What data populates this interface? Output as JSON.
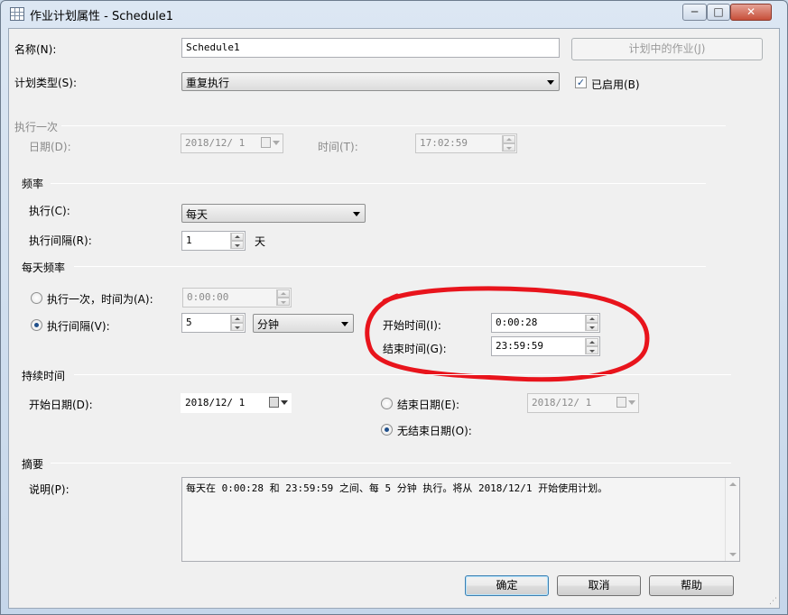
{
  "window": {
    "title": "作业计划属性 - Schedule1",
    "buttons": {
      "minimize": "─",
      "maximize": "□",
      "close": "✕"
    }
  },
  "name": {
    "label": "名称(N):",
    "value": "Schedule1"
  },
  "jobs_in_schedule_button": "计划中的作业(J)",
  "schedule_type": {
    "label": "计划类型(S):",
    "value": "重复执行"
  },
  "enabled": {
    "label": "已启用(B)",
    "checked": true
  },
  "one_time": {
    "section": "执行一次",
    "date_label": "日期(D):",
    "date_value": "2018/12/ 1",
    "time_label": "时间(T):",
    "time_value": "17:02:59"
  },
  "frequency": {
    "section": "频率",
    "occurs_label": "执行(C):",
    "occurs_value": "每天",
    "recurs_label": "执行间隔(R):",
    "recurs_value": "1",
    "recurs_unit": "天"
  },
  "daily_frequency": {
    "section": "每天频率",
    "once_label": "执行一次，时间为(A):",
    "once_value": "0:00:00",
    "every_label": "执行间隔(V):",
    "every_value": "5",
    "every_unit": "分钟",
    "selected": "every",
    "start_label": "开始时间(I):",
    "start_value": "0:00:28",
    "end_label": "结束时间(G):",
    "end_value": "23:59:59"
  },
  "duration": {
    "section": "持续时间",
    "start_label": "开始日期(D):",
    "start_value": "2018/12/ 1",
    "end_label": "结束日期(E):",
    "end_value": "2018/12/ 1",
    "no_end_label": "无结束日期(O):",
    "selected": "no_end"
  },
  "summary": {
    "section": "摘要",
    "desc_label": "说明(P):",
    "desc_value": "每天在 0:00:28 和 23:59:59 之间、每 5 分钟 执行。将从 2018/12/1 开始使用计划。"
  },
  "footer": {
    "ok": "确定",
    "cancel": "取消",
    "help": "帮助"
  },
  "colors": {
    "annotation": "#e8141c",
    "accent": "#1f4f8a"
  }
}
